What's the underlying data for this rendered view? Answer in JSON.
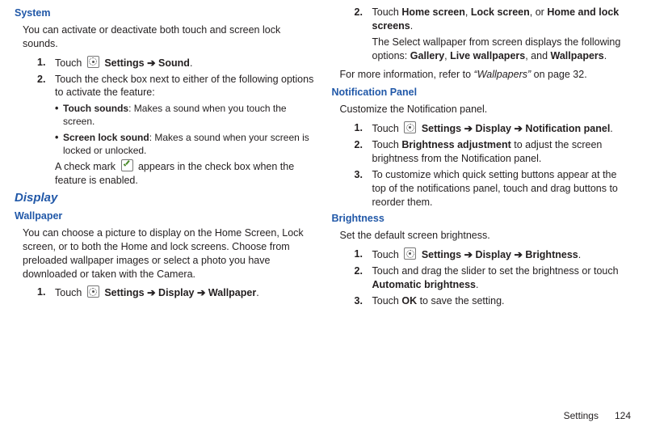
{
  "left": {
    "system_h": "System",
    "system_intro": "You can activate or deactivate both touch and screen lock sounds.",
    "s1_num": "1.",
    "s1_a": "Touch ",
    "s1_b": " Settings ➔ Sound",
    "s1_c": ".",
    "s2_num": "2.",
    "s2": "Touch the check box next to either of the following options to activate the feature:",
    "b1_label": "Touch sounds",
    "b1_rest": ": Makes a sound when you touch the screen.",
    "b2_label": "Screen lock sound",
    "b2_rest": ": Makes a sound when your screen is locked or unlocked.",
    "note_a": "A check mark ",
    "note_b": " appears in the check box when the feature is enabled.",
    "display_h": "Display",
    "wallpaper_h": "Wallpaper",
    "wallpaper_intro": "You can choose a picture to display on the Home Screen, Lock screen, or to both the Home and lock screens. Choose from preloaded wallpaper images or select a photo you have downloaded or taken with the Camera.",
    "w1_num": "1.",
    "w1_a": "Touch ",
    "w1_b": " Settings ➔ Display ➔ Wallpaper",
    "w1_c": "."
  },
  "right": {
    "r2_num": "2.",
    "r2_a": "Touch ",
    "r2_b": "Home screen",
    "r2_c": ", ",
    "r2_d": "Lock screen",
    "r2_e": ", or ",
    "r2_f": "Home and lock screens",
    "r2_g": ".",
    "r2_sub_a": "The Select wallpaper from screen displays the following options: ",
    "r2_sub_b": "Gallery",
    "r2_sub_c": ", ",
    "r2_sub_d": "Live wallpapers",
    "r2_sub_e": ", and ",
    "r2_sub_f": "Wallpapers",
    "r2_sub_g": ".",
    "more_a": "For more information, refer to ",
    "more_b": "“Wallpapers”",
    "more_c": " on page 32.",
    "notif_h": "Notification Panel",
    "notif_intro": "Customize the Notification panel.",
    "n1_num": "1.",
    "n1_a": "Touch ",
    "n1_b": " Settings ➔ Display ➔ Notification panel",
    "n1_c": ".",
    "n2_num": "2.",
    "n2_a": "Touch ",
    "n2_b": "Brightness adjustment",
    "n2_c": " to adjust the screen brightness from the Notification panel.",
    "n3_num": "3.",
    "n3": "To customize which quick setting buttons appear at the top of the notifications panel, touch and drag buttons to reorder them.",
    "bright_h": "Brightness",
    "bright_intro": "Set the default screen brightness.",
    "br1_num": "1.",
    "br1_a": "Touch ",
    "br1_b": " Settings ➔ Display ➔ Brightness",
    "br1_c": ".",
    "br2_num": "2.",
    "br2_a": "Touch and drag the slider to set the brightness or touch ",
    "br2_b": "Automatic brightness",
    "br2_c": ".",
    "br3_num": "3.",
    "br3_a": "Touch ",
    "br3_b": "OK",
    "br3_c": " to save the setting."
  },
  "footer": {
    "section": "Settings",
    "page": "124"
  }
}
